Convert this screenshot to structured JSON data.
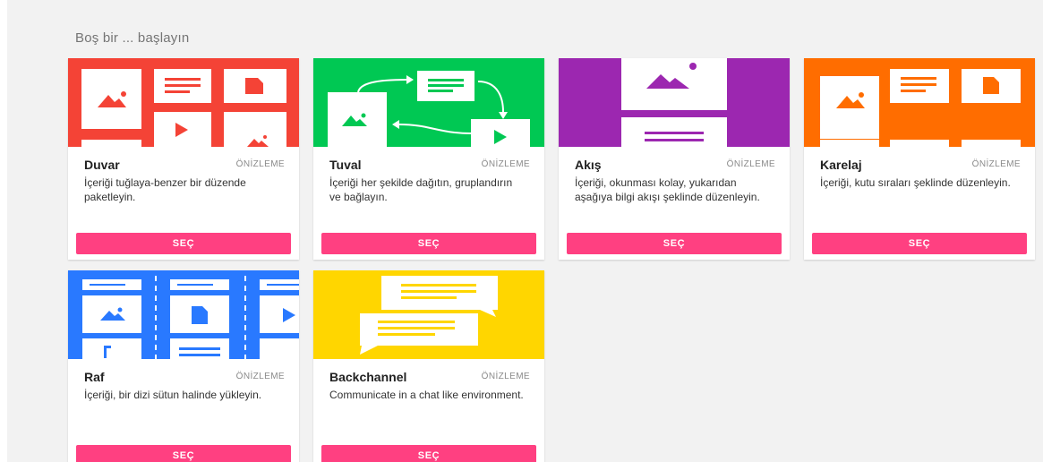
{
  "heading": "Boş bir ... başlayın",
  "preview_label": "ÖNİZLEME",
  "select_label": "SEÇ",
  "colors": {
    "accent_button": "#ff4081",
    "duvar": "#f44336",
    "tuval": "#00c853",
    "akis": "#9c27b0",
    "karelaj": "#ff6d00",
    "raf": "#2979ff",
    "backchannel": "#ffd600"
  },
  "cards": [
    {
      "title": "Duvar",
      "description": "İçeriği tuğlaya-benzer bir düzende paketleyin."
    },
    {
      "title": "Tuval",
      "description": "İçeriği her şekilde dağıtın, gruplandırın ve bağlayın."
    },
    {
      "title": "Akış",
      "description": "İçeriği, okunması kolay, yukarıdan aşağıya bilgi akışı şeklinde düzenleyin."
    },
    {
      "title": "Karelaj",
      "description": "İçeriği, kutu sıraları şeklinde düzenleyin."
    },
    {
      "title": "Raf",
      "description": "İçeriği, bir dizi sütun halinde yükleyin."
    },
    {
      "title": "Backchannel",
      "description": "Communicate in a chat like environment."
    }
  ]
}
